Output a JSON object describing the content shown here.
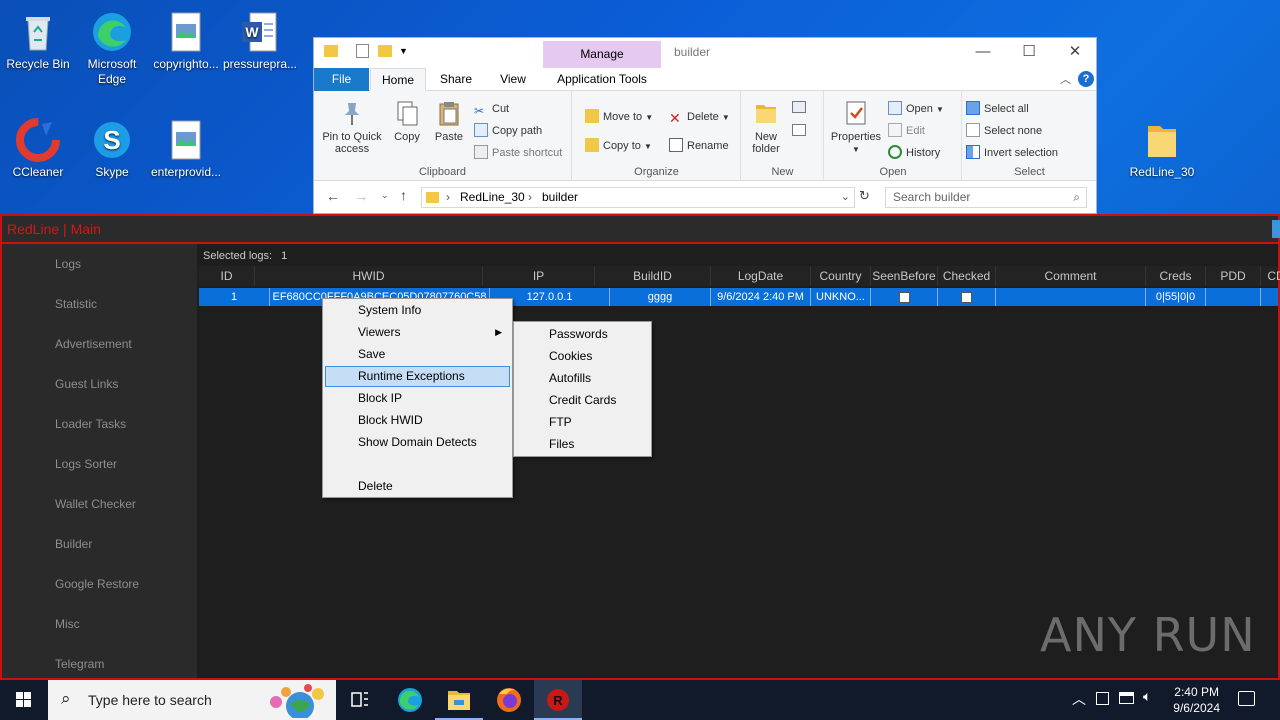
{
  "desktop": {
    "icons": [
      {
        "label": "Recycle Bin"
      },
      {
        "label": "Microsoft Edge"
      },
      {
        "label": "copyrighto..."
      },
      {
        "label": "pressurepra..."
      },
      {
        "label": "CCleaner"
      },
      {
        "label": "Skype"
      },
      {
        "label": "enterprovid..."
      },
      {
        "label": "RedLine_30"
      }
    ]
  },
  "explorer": {
    "title": "builder",
    "manage_tab": "Manage",
    "tabs": [
      "File",
      "Home",
      "Share",
      "View",
      "Application Tools"
    ],
    "ribbon": {
      "clipboard": {
        "name": "Clipboard",
        "pin": "Pin to Quick access",
        "copy": "Copy",
        "paste": "Paste",
        "cut": "Cut",
        "copy_path": "Copy path",
        "paste_shortcut": "Paste shortcut"
      },
      "organize": {
        "name": "Organize",
        "move_to": "Move to",
        "copy_to": "Copy to",
        "delete": "Delete",
        "rename": "Rename"
      },
      "new": {
        "name": "New",
        "new_folder": "New folder"
      },
      "open": {
        "name": "Open",
        "properties": "Properties",
        "open": "Open",
        "edit": "Edit",
        "history": "History"
      },
      "select": {
        "name": "Select",
        "select_all": "Select all",
        "select_none": "Select none",
        "invert": "Invert selection"
      }
    },
    "path": [
      "RedLine_30",
      "builder"
    ],
    "search_placeholder": "Search builder"
  },
  "redline": {
    "title": "RedLine | Main",
    "sidebar": [
      "Logs",
      "Statistic",
      "Advertisement",
      "Guest Links",
      "Loader Tasks",
      "Logs Sorter",
      "Wallet Checker",
      "Builder",
      "Google Restore",
      "Misc",
      "Telegram"
    ],
    "selected_logs_label": "Selected logs:",
    "selected_logs_count": "1",
    "columns": [
      "ID",
      "HWID",
      "IP",
      "BuildID",
      "LogDate",
      "Country",
      "SeenBefore",
      "Checked",
      "Comment",
      "Creds",
      "PDD",
      "CD"
    ],
    "row": {
      "id": "1",
      "hwid": "EF680CC0FFF0A9BCEC05D07807760C58",
      "ip": "127.0.0.1",
      "build_id": "gggg",
      "log_date": "9/6/2024 2:40 PM",
      "country": "UNKNO...",
      "seen_before": false,
      "checked": false,
      "comment": "",
      "creds": "0|55|0|0"
    },
    "context_menu": [
      "System Info",
      "Viewers",
      "Save",
      "Runtime Exceptions",
      "Block IP",
      "Block HWID",
      "Show Domain Detects",
      "Delete"
    ],
    "submenu": [
      "Passwords",
      "Cookies",
      "Autofills",
      "Credit Cards",
      "FTP",
      "Files"
    ]
  },
  "taskbar": {
    "search_placeholder": "Type here to search",
    "time": "2:40 PM",
    "date": "9/6/2024"
  },
  "watermark": "ANY RUN"
}
